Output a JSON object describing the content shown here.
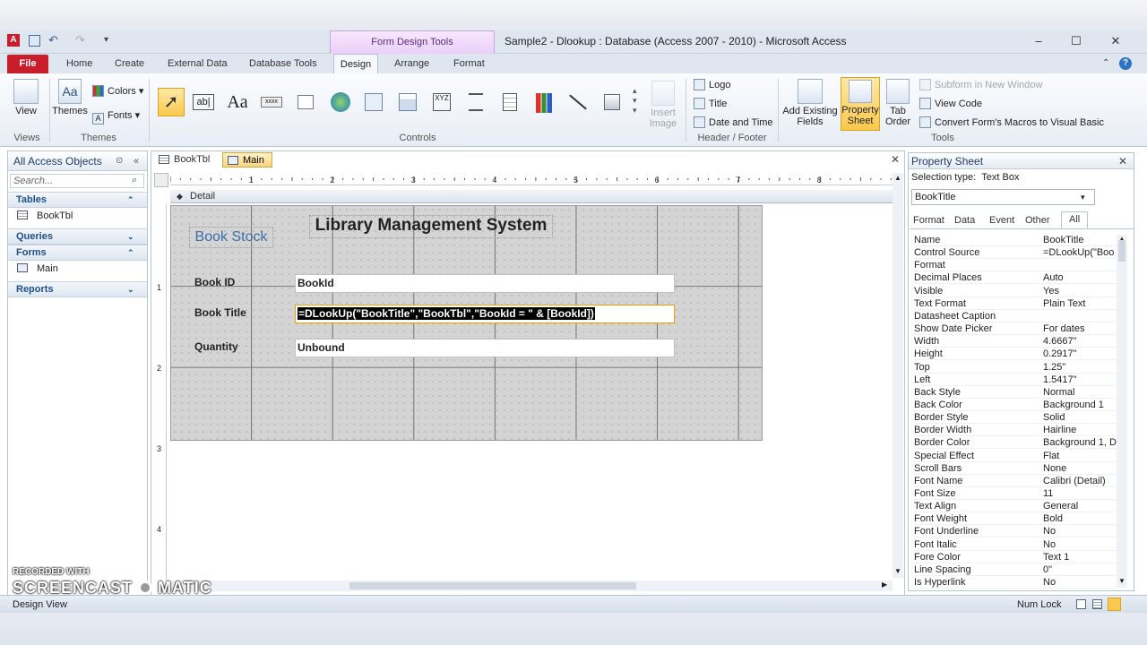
{
  "window": {
    "title": "Sample2 - Dlookup : Database (Access 2007 - 2010)  -  Microsoft Access",
    "context_tab": "Form Design Tools",
    "minimize": "–",
    "maximize": "☐",
    "close": "✕"
  },
  "ribbon_tabs": {
    "file": "File",
    "home": "Home",
    "create": "Create",
    "external_data": "External Data",
    "database_tools": "Database Tools",
    "design": "Design",
    "arrange": "Arrange",
    "format": "Format"
  },
  "ribbon": {
    "views": {
      "view": "View",
      "group": "Views"
    },
    "themes": {
      "themes": "Themes",
      "colors": "Colors",
      "fonts": "Fonts",
      "group": "Themes"
    },
    "controls": {
      "insert_image": "Insert Image",
      "group": "Controls"
    },
    "header_footer": {
      "logo": "Logo",
      "title": "Title",
      "date_time": "Date and Time",
      "group": "Header / Footer"
    },
    "tools": {
      "add_existing_fields": "Add Existing Fields",
      "property_sheet": "Property Sheet",
      "tab_order": "Tab Order",
      "subform_new_window": "Subform in New Window",
      "view_code": "View Code",
      "convert_macros": "Convert Form's Macros to Visual Basic",
      "group": "Tools"
    }
  },
  "nav_pane": {
    "header": "All Access Objects",
    "search_placeholder": "Search...",
    "sections": [
      {
        "title": "Tables",
        "items": [
          "BookTbl"
        ]
      },
      {
        "title": "Queries",
        "items": []
      },
      {
        "title": "Forms",
        "items": [
          "Main"
        ]
      },
      {
        "title": "Reports",
        "items": []
      }
    ]
  },
  "doc_tabs": [
    "BookTbl",
    "Main"
  ],
  "form": {
    "section": "Detail",
    "title": "Library Management System",
    "subtitle": "Book Stock",
    "fields": [
      {
        "label": "Book ID",
        "value": "BookId"
      },
      {
        "label": "Book Title",
        "value": "=DLookUp(\"BookTitle\",\"BookTbl\",\"BookId = \" & [BookId])"
      },
      {
        "label": "Quantity",
        "value": "Unbound"
      }
    ]
  },
  "property_sheet": {
    "title": "Property Sheet",
    "selection_type_label": "Selection type:",
    "selection_type": "Text Box",
    "selected_object": "BookTitle",
    "tabs": [
      "Format",
      "Data",
      "Event",
      "Other",
      "All"
    ],
    "rows": [
      [
        "Name",
        "BookTitle"
      ],
      [
        "Control Source",
        "=DLookUp(\"Boo"
      ],
      [
        "Format",
        ""
      ],
      [
        "Decimal Places",
        "Auto"
      ],
      [
        "Visible",
        "Yes"
      ],
      [
        "Text Format",
        "Plain Text"
      ],
      [
        "Datasheet Caption",
        ""
      ],
      [
        "Show Date Picker",
        "For dates"
      ],
      [
        "Width",
        "4.6667\""
      ],
      [
        "Height",
        "0.2917\""
      ],
      [
        "Top",
        "1.25\""
      ],
      [
        "Left",
        "1.5417\""
      ],
      [
        "Back Style",
        "Normal"
      ],
      [
        "Back Color",
        "Background 1"
      ],
      [
        "Border Style",
        "Solid"
      ],
      [
        "Border Width",
        "Hairline"
      ],
      [
        "Border Color",
        "Background 1, D"
      ],
      [
        "Special Effect",
        "Flat"
      ],
      [
        "Scroll Bars",
        "None"
      ],
      [
        "Font Name",
        "Calibri (Detail)"
      ],
      [
        "Font Size",
        "11"
      ],
      [
        "Text Align",
        "General"
      ],
      [
        "Font Weight",
        "Bold"
      ],
      [
        "Font Underline",
        "No"
      ],
      [
        "Font Italic",
        "No"
      ],
      [
        "Fore Color",
        "Text 1"
      ],
      [
        "Line Spacing",
        "0\""
      ],
      [
        "Is Hyperlink",
        "No"
      ]
    ]
  },
  "status": {
    "left": "Design View",
    "right": "Num Lock"
  },
  "watermark": {
    "line1": "RECORDED WITH",
    "line2": "SCREENCAST",
    "line3": "MATIC"
  },
  "colors": {
    "file_tab": "#c81d2a",
    "context_tab": "#e9d0f7",
    "accent": "#f9c84d"
  }
}
